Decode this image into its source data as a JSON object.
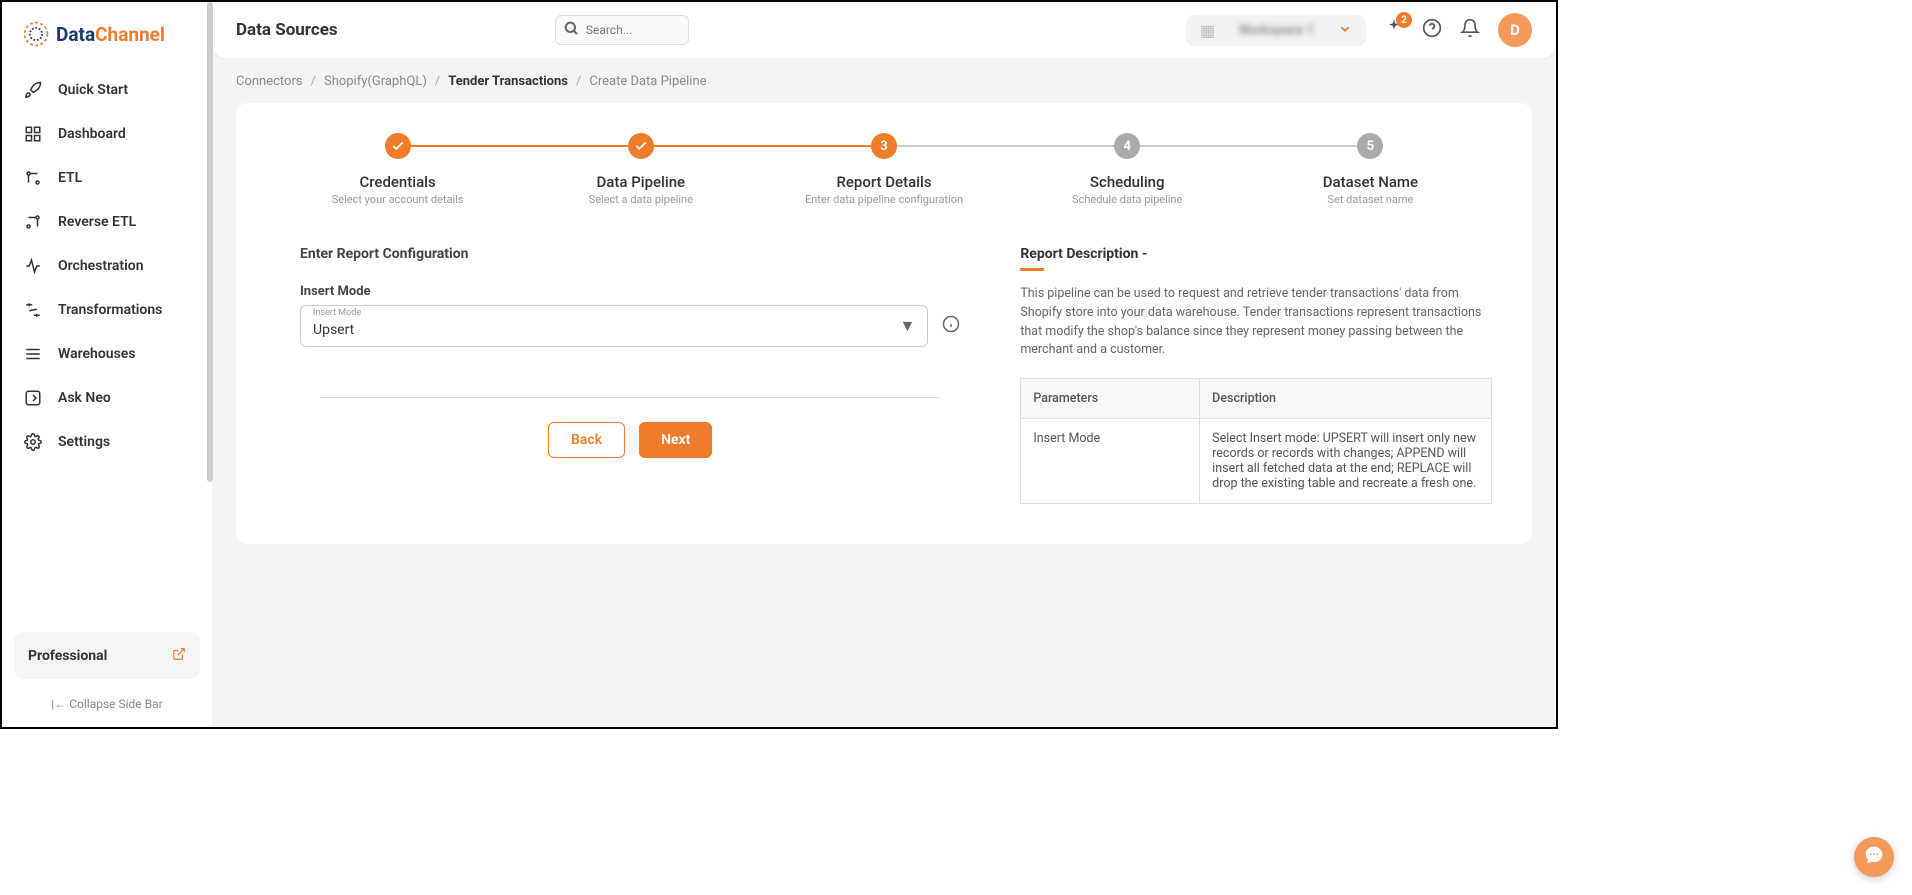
{
  "logo": {
    "part1": "Data",
    "part2": "Channel"
  },
  "sidebar": {
    "items": [
      {
        "label": "Quick Start",
        "icon": "rocket-icon"
      },
      {
        "label": "Dashboard",
        "icon": "dashboard-icon"
      },
      {
        "label": "ETL",
        "icon": "etl-icon"
      },
      {
        "label": "Reverse ETL",
        "icon": "reverse-etl-icon"
      },
      {
        "label": "Orchestration",
        "icon": "orchestration-icon"
      },
      {
        "label": "Transformations",
        "icon": "transform-icon"
      },
      {
        "label": "Warehouses",
        "icon": "warehouse-icon"
      },
      {
        "label": "Ask Neo",
        "icon": "ask-neo-icon"
      },
      {
        "label": "Settings",
        "icon": "settings-icon"
      }
    ],
    "plan_label": "Professional",
    "collapse_label": "Collapse Side Bar"
  },
  "header": {
    "page_title": "Data Sources",
    "search_placeholder": "Search...",
    "workspace_label": "Workspace 1",
    "badge_count": "2",
    "avatar_letter": "D"
  },
  "breadcrumb": {
    "items": [
      "Connectors",
      "Shopify(GraphQL)",
      "Tender Transactions",
      "Create Data Pipeline"
    ],
    "active_index": 2
  },
  "stepper": {
    "steps": [
      {
        "title": "Credentials",
        "sub": "Select your account details",
        "state": "done"
      },
      {
        "title": "Data Pipeline",
        "sub": "Select a data pipeline",
        "state": "done"
      },
      {
        "title": "Report Details",
        "sub": "Enter data pipeline configuration",
        "state": "active",
        "num": "3"
      },
      {
        "title": "Scheduling",
        "sub": "Schedule data pipeline",
        "state": "pending",
        "num": "4"
      },
      {
        "title": "Dataset Name",
        "sub": "Set dataset name",
        "state": "pending",
        "num": "5"
      }
    ]
  },
  "form": {
    "section_heading": "Enter Report Configuration",
    "field_label": "Insert Mode",
    "select_mini_label": "Insert Mode",
    "select_value": "Upsert",
    "back_label": "Back",
    "next_label": "Next"
  },
  "description": {
    "heading": "Report Description -",
    "text": "This pipeline can be used to request and retrieve tender transactions' data from Shopify store into your data warehouse. Tender transactions represent transactions that modify the shop's balance since they represent money passing between the merchant and a customer.",
    "table": {
      "headers": [
        "Parameters",
        "Description"
      ],
      "rows": [
        {
          "param": "Insert Mode",
          "desc": "Select Insert mode: UPSERT will insert only new records or records with changes; APPEND will insert all fetched data at the end; REPLACE will drop the existing table and recreate a fresh one."
        }
      ]
    }
  }
}
